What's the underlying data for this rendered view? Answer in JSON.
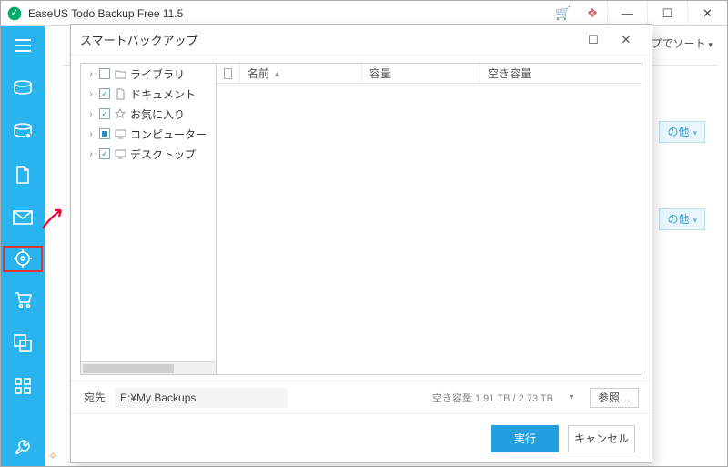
{
  "app": {
    "title": "EaseUS Todo Backup Free 11.5"
  },
  "toolbar": {
    "shop_icon": "shop",
    "present_icon": "gift",
    "minimize": "—",
    "maximize": "☐",
    "close": "✕"
  },
  "behind": {
    "sort_label": "プでソート",
    "sort_chev": "▾",
    "chip1_label": "の他",
    "chip2_label": "の他"
  },
  "sidebar": {
    "items": [
      {
        "name": "menu"
      },
      {
        "name": "disk-backup"
      },
      {
        "name": "system-backup"
      },
      {
        "name": "file-backup"
      },
      {
        "name": "mail-backup"
      },
      {
        "name": "smart-backup"
      },
      {
        "name": "store"
      },
      {
        "name": "clone"
      },
      {
        "name": "tools"
      },
      {
        "name": "settings"
      }
    ]
  },
  "dialog": {
    "title": "スマートバックアップ",
    "maximize": "☐",
    "close": "✕",
    "tree": [
      {
        "label": "ライブラリ",
        "checked": "unchecked",
        "icon": "folder"
      },
      {
        "label": "ドキュメント",
        "checked": "checked",
        "icon": "document"
      },
      {
        "label": "お気に入り",
        "checked": "checked",
        "icon": "favorites"
      },
      {
        "label": "コンピューター",
        "checked": "partial",
        "icon": "computer"
      },
      {
        "label": "デスクトップ",
        "checked": "checked",
        "icon": "desktop"
      }
    ],
    "columns": {
      "name": "名前",
      "capacity": "容量",
      "free": "空き容量",
      "sort_arrow": "▲"
    },
    "destination": {
      "label": "宛先",
      "path": "E:¥My Backups",
      "free_prefix": "空き容量",
      "free_value": "1.91 TB / 2.73 TB",
      "dropdown": "▾",
      "browse": "参照…"
    },
    "buttons": {
      "run": "実行",
      "cancel": "キャンセル"
    }
  }
}
